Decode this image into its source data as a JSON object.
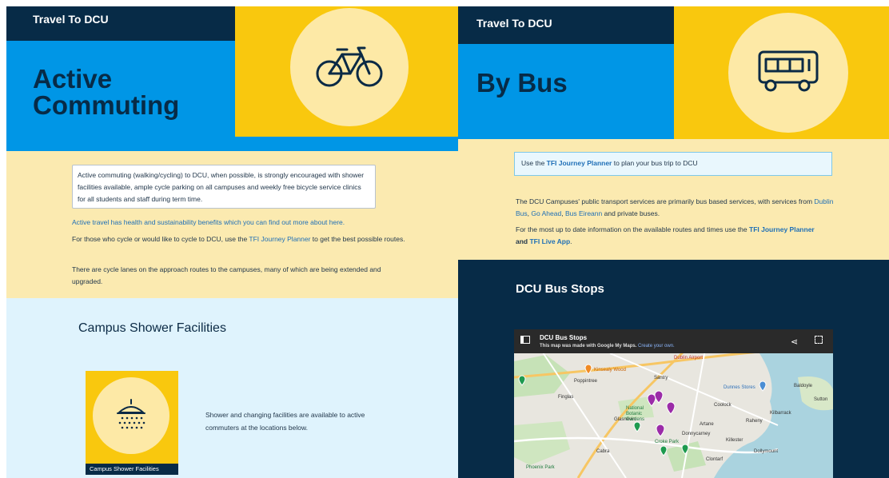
{
  "left": {
    "kicker": "Travel To DCU",
    "title_line1": "Active",
    "title_line2": "Commuting",
    "hero_icon": "bicycle-icon",
    "intro_box": "Active commuting (walking/cycling) to DCU, when possible, is strongly encouraged with shower facilities available, ample cycle parking on all campuses and weekly free bicycle service clinics for all students and staff during term time.",
    "health_link": "Active travel has health and sustainability benefits which you can find out more about here.",
    "p1_before": "For those who cycle or would like to cycle to DCU, use the ",
    "p1_link": "TFI Journey Planner",
    "p1_after": " to get the best possible routes.",
    "p2": "There are cycle lanes on the approach routes to the campuses, many of which are being extended and upgraded.",
    "shower_section_title": "Campus Shower Facilities",
    "shower_icon": "shower-icon",
    "shower_card_label": "Campus Shower Facilities",
    "shower_text": "Shower and changing facilities are available to active commuters at the locations below."
  },
  "right": {
    "kicker": "Travel To DCU",
    "title": "By Bus",
    "hero_icon": "bus-icon",
    "planner_box_before": "Use the ",
    "planner_box_link": "TFI Journey Planner",
    "planner_box_after": " to plan your bus trip to DCU",
    "services_before": "The DCU Campuses' public transport services are primarily bus based services, with services from ",
    "services_link1": "Dublin Bus",
    "services_sep1": ", ",
    "services_link2": "Go Ahead",
    "services_sep2": ", ",
    "services_link3": "Bus Eireann",
    "services_after": " and private buses.",
    "uptodate_before": "For the most up to date information on the available routes and times use the ",
    "uptodate_link1": "TFI Journey Planner",
    "uptodate_mid": " and ",
    "uptodate_link2": "TFI Live App",
    "uptodate_after": ".",
    "bus_stops_title": "DCU Bus Stops",
    "map": {
      "title": "DCU Bus Stops",
      "subtitle_bold": "This map was made with Google My Maps.",
      "subtitle_link": "Create your own.",
      "labels": [
        "Kinsealy Wood",
        "Santry",
        "Coolock",
        "Artane",
        "Raheny",
        "Kilbarrack",
        "Baldoyle",
        "Sutton",
        "Donnycarney",
        "Killester",
        "Cabra",
        "Croke Park",
        "Clontarf",
        "Phoenix Park",
        "Dollymount",
        "Glasnevin",
        "Dunnes Stores",
        "Poppintree",
        "National Botanic Gardens",
        "Dublin Airport",
        "Finglas"
      ]
    }
  },
  "colors": {
    "navy": "#072b47",
    "blue": "#0096e6",
    "yellow": "#f9c80e",
    "cream": "#fbeab0",
    "light_blue": "#dff3fd",
    "link": "#1f6fb6"
  }
}
